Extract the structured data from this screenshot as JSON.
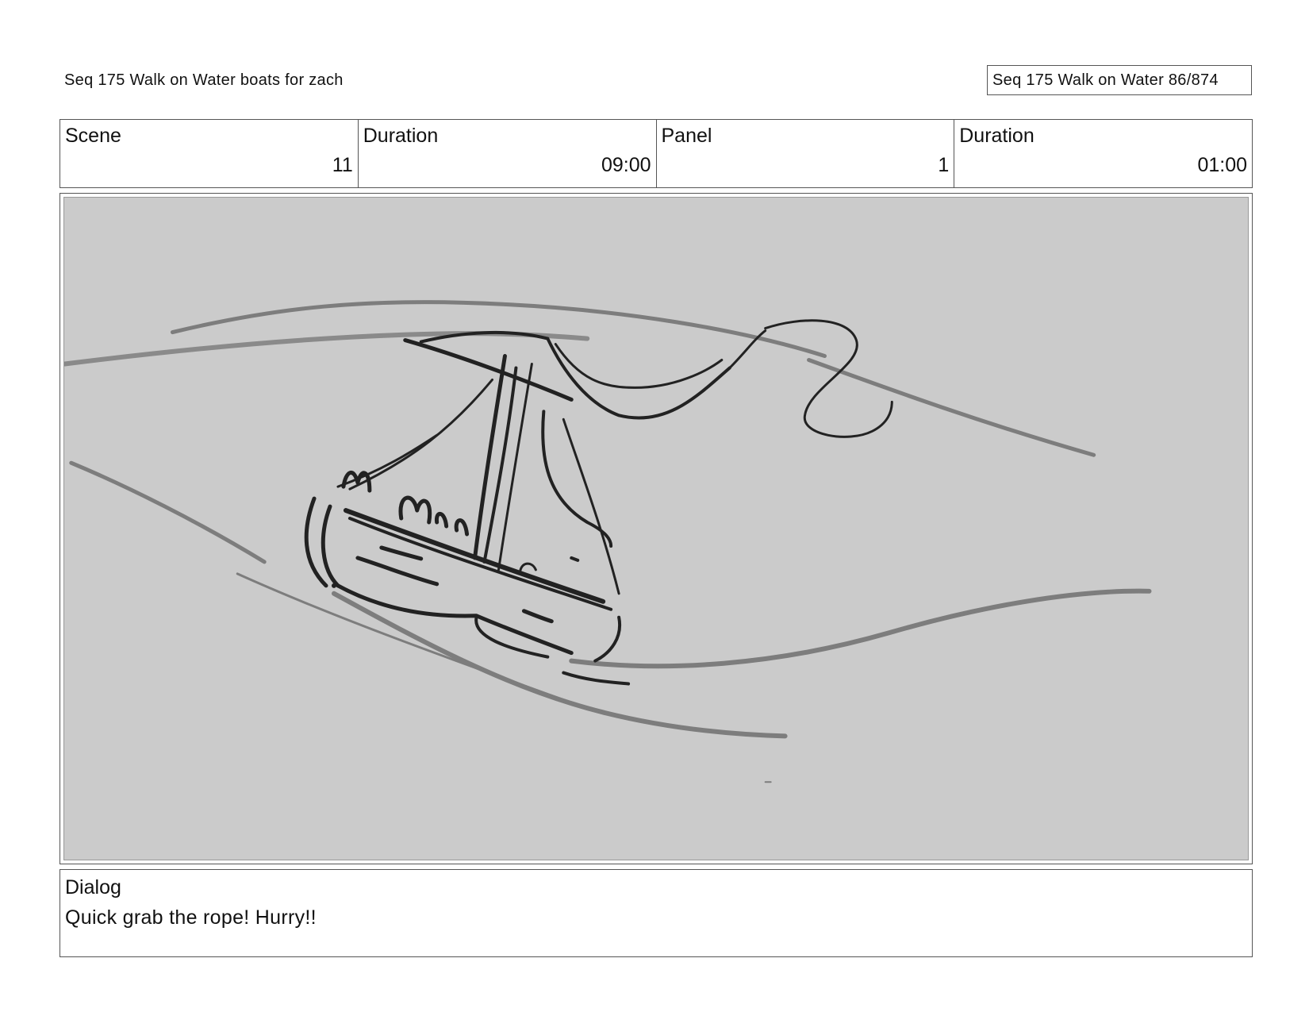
{
  "header": {
    "title_left": "Seq 175 Walk on Water  boats for zach",
    "title_right": "Seq 175 Walk on Water  86/874"
  },
  "info": {
    "scene_label": "Scene",
    "scene_value": "11",
    "scene_duration_label": "Duration",
    "scene_duration_value": "09:00",
    "panel_label": "Panel",
    "panel_value": "1",
    "panel_duration_label": "Duration",
    "panel_duration_value": "01:00"
  },
  "panel": {
    "image_description": "sketch-boat-on-waves",
    "background_color": "#cbcbcb"
  },
  "dialog": {
    "label": "Dialog",
    "text": "Quick grab the rope! Hurry!!"
  }
}
